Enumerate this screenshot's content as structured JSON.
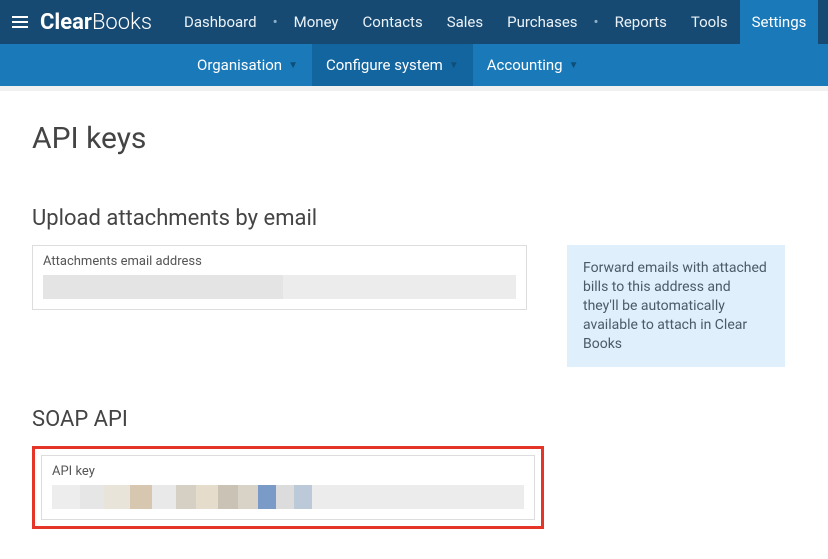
{
  "brand": {
    "part1": "Clear",
    "part2": "Books"
  },
  "topnav": {
    "items": [
      {
        "label": "Dashboard"
      },
      {
        "label": "Money"
      },
      {
        "label": "Contacts"
      },
      {
        "label": "Sales"
      },
      {
        "label": "Purchases"
      },
      {
        "label": "Reports"
      },
      {
        "label": "Tools"
      },
      {
        "label": "Settings"
      }
    ]
  },
  "subnav": {
    "items": [
      {
        "label": "Organisation"
      },
      {
        "label": "Configure system"
      },
      {
        "label": "Accounting"
      }
    ]
  },
  "page": {
    "title": "API keys",
    "upload": {
      "heading": "Upload attachments by email",
      "card_label": "Attachments email address",
      "info": "Forward emails with attached bills to this address and they'll be automatically available to attach in Clear Books"
    },
    "soap": {
      "heading": "SOAP API",
      "card_label": "API key"
    }
  }
}
